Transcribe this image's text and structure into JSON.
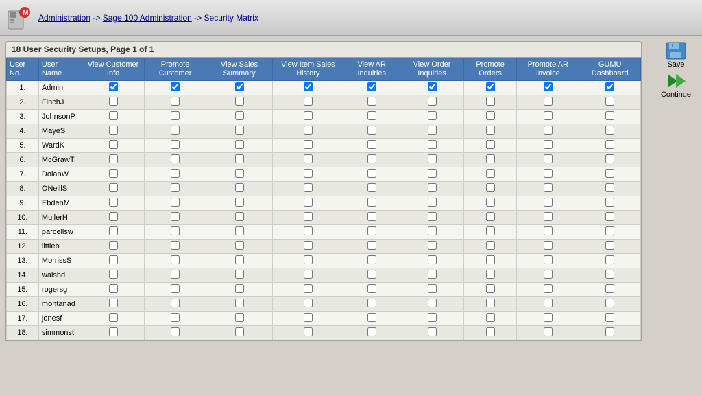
{
  "header": {
    "breadcrumb_admin": "Administration",
    "breadcrumb_arrow1": "->",
    "breadcrumb_sage": "Sage 100 Administration",
    "breadcrumb_arrow2": "->",
    "breadcrumb_current": "Security Matrix"
  },
  "toolbar": {
    "save_label": "Save",
    "continue_label": "Continue"
  },
  "tab": {
    "title": "18 User Security Setups, Page 1 of 1"
  },
  "table": {
    "columns": [
      {
        "id": "user_no",
        "label": "User No."
      },
      {
        "id": "user_name",
        "label": "User Name"
      },
      {
        "id": "view_customer_info",
        "label": "View Customer Info"
      },
      {
        "id": "promote_customer",
        "label": "Promote Customer"
      },
      {
        "id": "view_sales_summary",
        "label": "View Sales Summary"
      },
      {
        "id": "view_item_sales_history",
        "label": "View Item Sales History"
      },
      {
        "id": "view_ar_inquiries",
        "label": "View AR Inquiries"
      },
      {
        "id": "view_order_inquiries",
        "label": "View Order Inquiries"
      },
      {
        "id": "promote_orders",
        "label": "Promote Orders"
      },
      {
        "id": "promote_ar_invoice",
        "label": "Promote AR Invoice"
      },
      {
        "id": "gumu_dashboard",
        "label": "GUMU Dashboard"
      }
    ],
    "rows": [
      {
        "no": "1.",
        "name": "Admin",
        "view_cust": true,
        "promote_cust": true,
        "view_sales": true,
        "view_item": true,
        "view_ar": true,
        "view_order": true,
        "promote_orders": true,
        "promote_ar": true,
        "gumu": true
      },
      {
        "no": "2.",
        "name": "FinchJ",
        "view_cust": false,
        "promote_cust": false,
        "view_sales": false,
        "view_item": false,
        "view_ar": false,
        "view_order": false,
        "promote_orders": false,
        "promote_ar": false,
        "gumu": false
      },
      {
        "no": "3.",
        "name": "JohnsonP",
        "view_cust": false,
        "promote_cust": false,
        "view_sales": false,
        "view_item": false,
        "view_ar": false,
        "view_order": false,
        "promote_orders": false,
        "promote_ar": false,
        "gumu": false
      },
      {
        "no": "4.",
        "name": "MayeS",
        "view_cust": false,
        "promote_cust": false,
        "view_sales": false,
        "view_item": false,
        "view_ar": false,
        "view_order": false,
        "promote_orders": false,
        "promote_ar": false,
        "gumu": false
      },
      {
        "no": "5.",
        "name": "WardK",
        "view_cust": false,
        "promote_cust": false,
        "view_sales": false,
        "view_item": false,
        "view_ar": false,
        "view_order": false,
        "promote_orders": false,
        "promote_ar": false,
        "gumu": false
      },
      {
        "no": "6.",
        "name": "McGrawT",
        "view_cust": false,
        "promote_cust": false,
        "view_sales": false,
        "view_item": false,
        "view_ar": false,
        "view_order": false,
        "promote_orders": false,
        "promote_ar": false,
        "gumu": false
      },
      {
        "no": "7.",
        "name": "DolanW",
        "view_cust": false,
        "promote_cust": false,
        "view_sales": false,
        "view_item": false,
        "view_ar": false,
        "view_order": false,
        "promote_orders": false,
        "promote_ar": false,
        "gumu": false
      },
      {
        "no": "8.",
        "name": "ONeillS",
        "view_cust": false,
        "promote_cust": false,
        "view_sales": false,
        "view_item": false,
        "view_ar": false,
        "view_order": false,
        "promote_orders": false,
        "promote_ar": false,
        "gumu": false
      },
      {
        "no": "9.",
        "name": "EbdenM",
        "view_cust": false,
        "promote_cust": false,
        "view_sales": false,
        "view_item": false,
        "view_ar": false,
        "view_order": false,
        "promote_orders": false,
        "promote_ar": false,
        "gumu": false
      },
      {
        "no": "10.",
        "name": "MullerH",
        "view_cust": false,
        "promote_cust": false,
        "view_sales": false,
        "view_item": false,
        "view_ar": false,
        "view_order": false,
        "promote_orders": false,
        "promote_ar": false,
        "gumu": false
      },
      {
        "no": "11.",
        "name": "parcellsw",
        "view_cust": false,
        "promote_cust": false,
        "view_sales": false,
        "view_item": false,
        "view_ar": false,
        "view_order": false,
        "promote_orders": false,
        "promote_ar": false,
        "gumu": false
      },
      {
        "no": "12.",
        "name": "littleb",
        "view_cust": false,
        "promote_cust": false,
        "view_sales": false,
        "view_item": false,
        "view_ar": false,
        "view_order": false,
        "promote_orders": false,
        "promote_ar": false,
        "gumu": false
      },
      {
        "no": "13.",
        "name": "MorrissS",
        "view_cust": false,
        "promote_cust": false,
        "view_sales": false,
        "view_item": false,
        "view_ar": false,
        "view_order": false,
        "promote_orders": false,
        "promote_ar": false,
        "gumu": false
      },
      {
        "no": "14.",
        "name": "walshd",
        "view_cust": false,
        "promote_cust": false,
        "view_sales": false,
        "view_item": false,
        "view_ar": false,
        "view_order": false,
        "promote_orders": false,
        "promote_ar": false,
        "gumu": false
      },
      {
        "no": "15.",
        "name": "rogersg",
        "view_cust": false,
        "promote_cust": false,
        "view_sales": false,
        "view_item": false,
        "view_ar": false,
        "view_order": false,
        "promote_orders": false,
        "promote_ar": false,
        "gumu": false
      },
      {
        "no": "16.",
        "name": "montanad",
        "view_cust": false,
        "promote_cust": false,
        "view_sales": false,
        "view_item": false,
        "view_ar": false,
        "view_order": false,
        "promote_orders": false,
        "promote_ar": false,
        "gumu": false
      },
      {
        "no": "17.",
        "name": "jonesf",
        "view_cust": false,
        "promote_cust": false,
        "view_sales": false,
        "view_item": false,
        "view_ar": false,
        "view_order": false,
        "promote_orders": false,
        "promote_ar": false,
        "gumu": false
      },
      {
        "no": "18.",
        "name": "simmonst",
        "view_cust": false,
        "promote_cust": false,
        "view_sales": false,
        "view_item": false,
        "view_ar": false,
        "view_order": false,
        "promote_orders": false,
        "promote_ar": false,
        "gumu": false
      }
    ]
  }
}
